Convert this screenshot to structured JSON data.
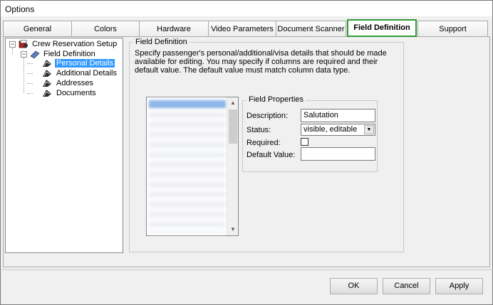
{
  "window": {
    "title": "Options"
  },
  "tabs": [
    {
      "label": "General"
    },
    {
      "label": "Colors"
    },
    {
      "label": "Hardware"
    },
    {
      "label": "Video Parameters"
    },
    {
      "label": "Document Scanner"
    },
    {
      "label": "Field Definition"
    },
    {
      "label": "Support"
    }
  ],
  "active_tab": "Field Definition",
  "tree": {
    "root": "Crew Reservation Setup",
    "child": "Field Definition",
    "items": [
      "Personal Details",
      "Additional Details",
      "Addresses",
      "Documents"
    ],
    "selected": "Personal Details"
  },
  "field_definition": {
    "group_title": "Field Definition",
    "description": "Specify passenger's personal/additional/visa details that should be made available for editing. You may specify if columns are required and their default value. The default value must match column data type."
  },
  "field_properties": {
    "group_title": "Field Properties",
    "description_label": "Description:",
    "description_value": "Salutation",
    "status_label": "Status:",
    "status_value": "visible, editable",
    "required_label": "Required:",
    "required_checked": false,
    "default_label": "Default Value:",
    "default_value": ""
  },
  "buttons": {
    "ok": "OK",
    "cancel": "Cancel",
    "apply": "Apply"
  },
  "colors": {
    "active_tab_border": "#2f9a35",
    "selection": "#3399ff"
  }
}
